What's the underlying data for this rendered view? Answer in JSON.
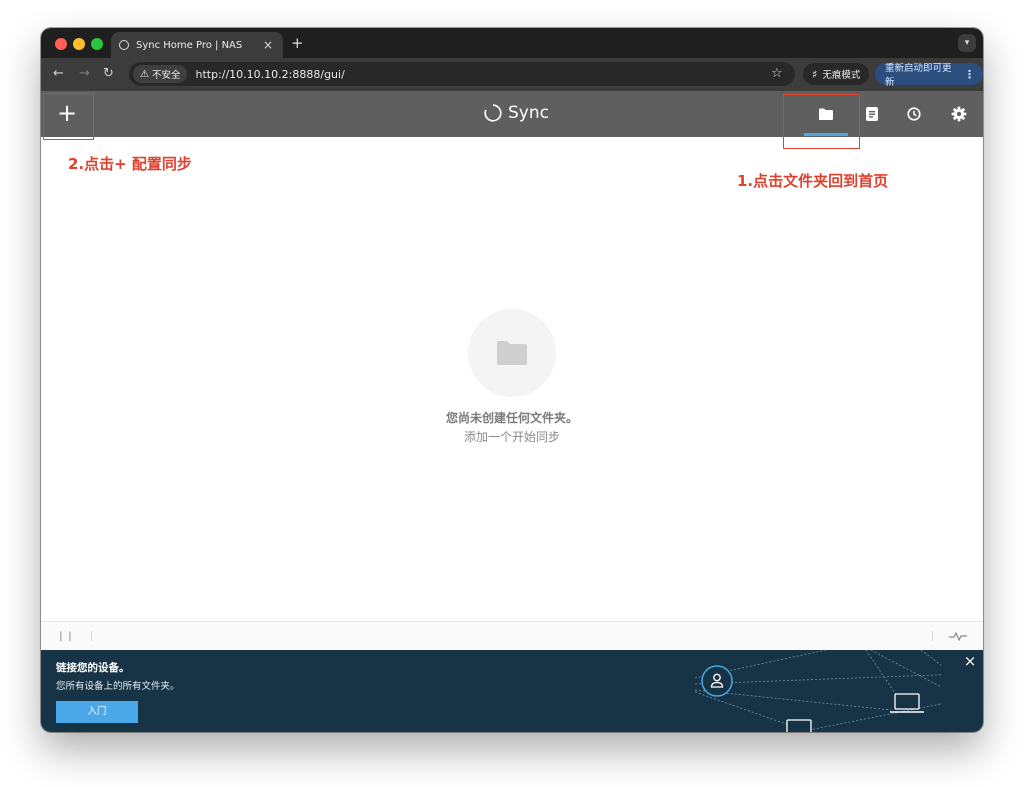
{
  "browser": {
    "tab_title": "Sync Home Pro | NAS",
    "tab_close": "×",
    "new_tab": "+",
    "security_label": "不安全",
    "url": "http://10.10.10.2:8888/gui/",
    "incognito_label": "无痕模式",
    "update_label": "重新启动即可更新"
  },
  "app": {
    "brand": "Sync",
    "add_button": "+",
    "nav": [
      "folders-icon",
      "log-icon",
      "history-icon",
      "settings-icon"
    ]
  },
  "annotations": {
    "step1": "1.点击文件夹回到首页",
    "step2": "2.点击+ 配置同步"
  },
  "empty_state": {
    "title": "您尚未创建任何文件夹。",
    "subtitle": "添加一个开始同步"
  },
  "banner": {
    "title": "链接您的设备。",
    "text": "您所有设备上的所有文件夹。",
    "button": "入门",
    "close": "×"
  },
  "colors": {
    "header": "#5f5f5f",
    "accent": "#4aa8e8",
    "annotation": "#e0412f",
    "banner": "#163446"
  }
}
